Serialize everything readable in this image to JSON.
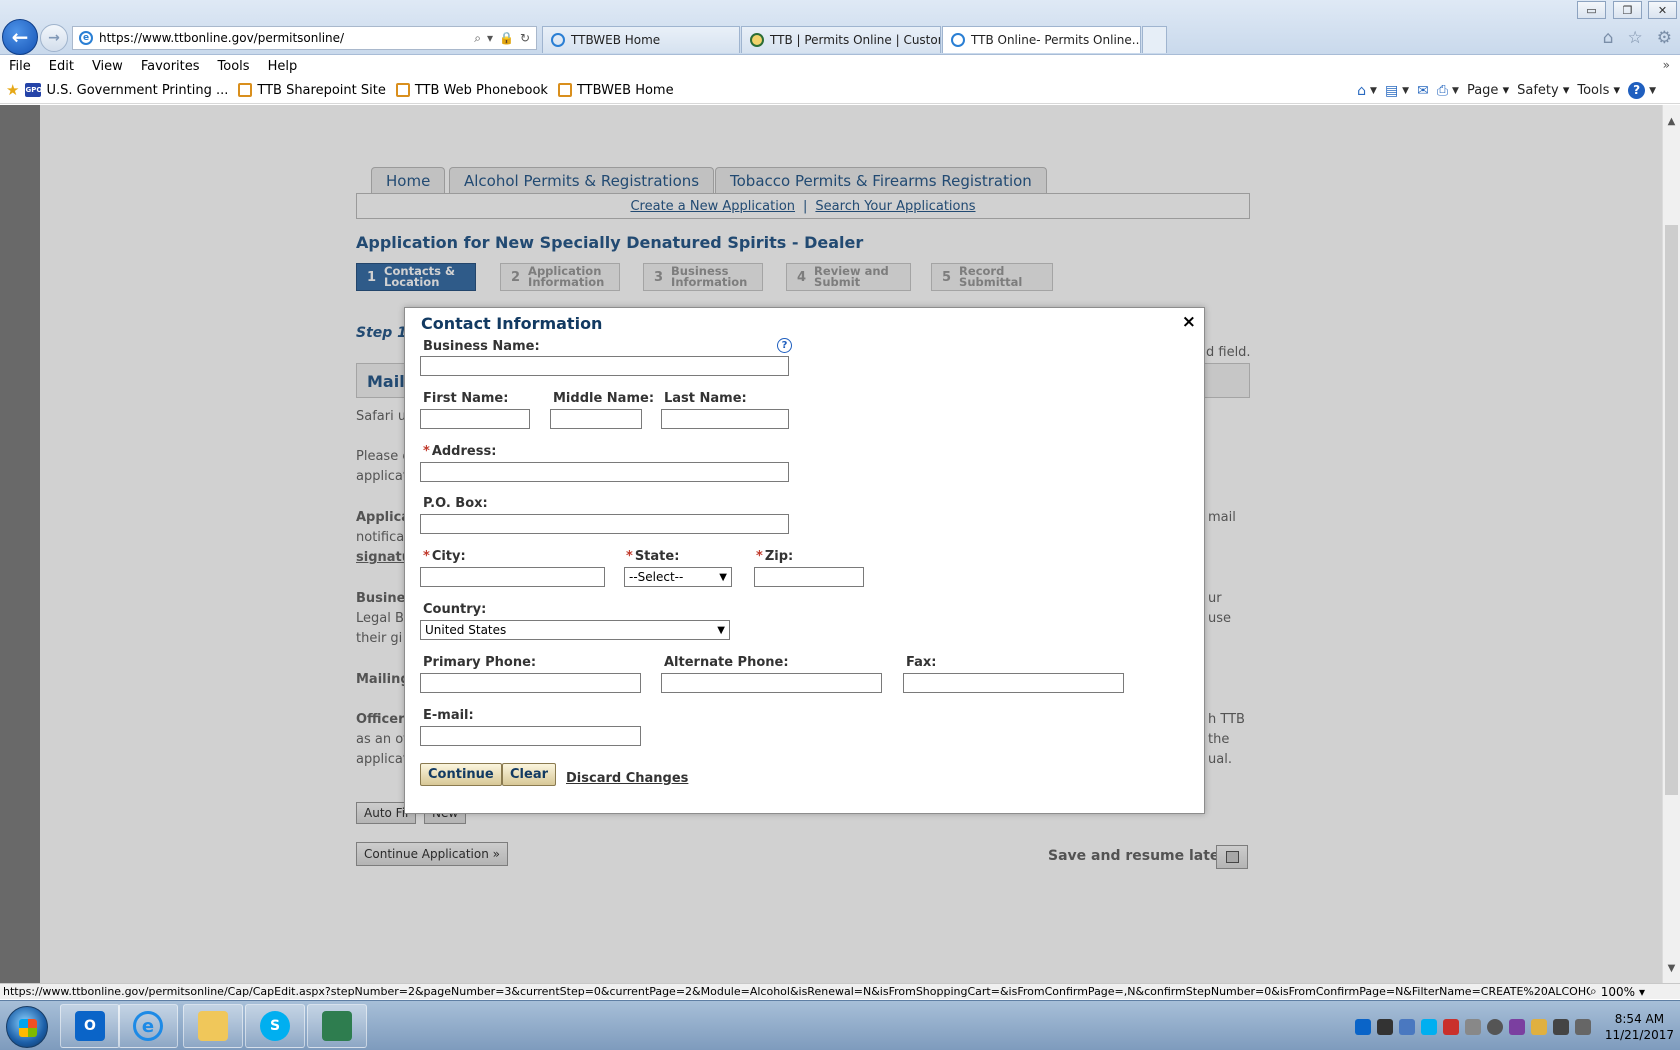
{
  "browser": {
    "address_url": "https://www.ttbonline.gov/permitsonline/",
    "tabs": [
      {
        "title": "TTBWEB Home"
      },
      {
        "title": "TTB | Permits Online | Custom..."
      },
      {
        "title": "TTB Online- Permits Online..."
      }
    ],
    "menu": [
      "File",
      "Edit",
      "View",
      "Favorites",
      "Tools",
      "Help"
    ],
    "favorites": [
      {
        "label": "U.S. Government Printing ...",
        "icon": "gpo-icon"
      },
      {
        "label": "TTB Sharepoint Site",
        "icon": "favorite-icon"
      },
      {
        "label": "TTB Web Phonebook",
        "icon": "favorite-icon"
      },
      {
        "label": "TTBWEB Home",
        "icon": "favorite-icon"
      }
    ],
    "command_bar": {
      "page": "Page",
      "safety": "Safety",
      "tools": "Tools"
    },
    "status_url": "https://www.ttbonline.gov/permitsonline/Cap/CapEdit.aspx?stepNumber=2&pageNumber=3&currentStep=0&currentPage=2&Module=Alcohol&isRenewal=N&isFromShoppingCart=&isFromConfirmPage=,N&confirmStepNumber=0&isFromConfirmPage=N&FilterName=CREATE%20ALCOHOL%",
    "zoom": "100%"
  },
  "page": {
    "nav_tabs": [
      "Home",
      "Alcohol Permits & Registrations",
      "Tobacco Permits & Firearms Registration"
    ],
    "subnav": {
      "create": "Create a New Application",
      "separator": "|",
      "search": "Search Your Applications"
    },
    "title": "Application for New Specially Denatured Spirits - Dealer",
    "steps": [
      {
        "num": "1",
        "label": "Contacts & Location"
      },
      {
        "num": "2",
        "label": "Application Information"
      },
      {
        "num": "3",
        "label": "Business Information"
      },
      {
        "num": "4",
        "label": "Review and Submit"
      },
      {
        "num": "5",
        "label": "Record Submittal"
      }
    ],
    "step_heading": "Step 1",
    "required_note": "d field.",
    "section_title": "Mailin",
    "bg_left": [
      "Safari u",
      "Please e",
      "applicat",
      "Applica",
      "notificat",
      "signatu",
      "Busine",
      "Legal B",
      "their gi",
      "Mailing",
      "Officer",
      "as an of",
      "applicat"
    ],
    "bg_right": [
      "mail",
      "ur",
      "use",
      "h TTB",
      "the",
      "ual."
    ],
    "buttons": {
      "auto_fill": "Auto Fil",
      "new": "New",
      "continue_application": "Continue Application »"
    },
    "save_resume": "Save and resume later:"
  },
  "modal": {
    "title": "Contact Information",
    "close": "×",
    "help": "?",
    "labels": {
      "business_name": "Business Name:",
      "first_name": "First Name:",
      "middle_name": "Middle Name:",
      "last_name": "Last Name:",
      "address": "Address:",
      "po_box": "P.O. Box:",
      "city": "City:",
      "state": "State:",
      "zip": "Zip:",
      "country": "Country:",
      "primary_phone": "Primary Phone:",
      "alternate_phone": "Alternate Phone:",
      "fax": "Fax:",
      "email": "E-mail:"
    },
    "required_marker": "*",
    "values": {
      "business_name": "",
      "first_name": "",
      "middle_name": "",
      "last_name": "",
      "address": "",
      "po_box": "",
      "city": "",
      "zip": "",
      "primary_phone": "",
      "alternate_phone": "",
      "fax": "",
      "email": ""
    },
    "state_selected": "--Select--",
    "country_selected": "United States",
    "buttons": {
      "continue": "Continue",
      "clear": "Clear",
      "discard": "Discard Changes"
    }
  },
  "taskbar": {
    "clock_time": "8:54 AM",
    "clock_date": "11/21/2017"
  }
}
